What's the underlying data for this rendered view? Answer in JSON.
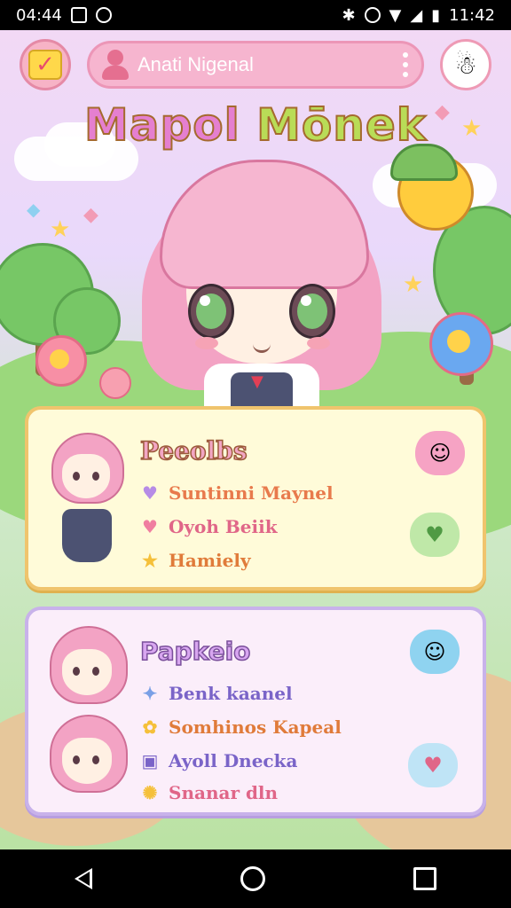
{
  "status_bar": {
    "time": "04:44",
    "clock_right": "11:42",
    "signal_label": "R"
  },
  "search": {
    "placeholder": "Anati Nigenal"
  },
  "app": {
    "title_part1": "Mapol",
    "title_part2": "Mōnek"
  },
  "card1": {
    "title": "Peeolbs",
    "items": [
      {
        "icon": "heart-icon",
        "text": "Suntinni Maynel",
        "color": "#e87a4c"
      },
      {
        "icon": "heart-icon",
        "text": "Oyoh Beiik",
        "color": "#e06688"
      },
      {
        "icon": "star-icon",
        "text": "Hamiely",
        "color": "#e07b3a"
      }
    ]
  },
  "card2": {
    "title": "Papkeio",
    "items": [
      {
        "icon": "sparkle-icon",
        "text": "Benk kaanel",
        "color": "#7a64c8"
      },
      {
        "icon": "flower-icon",
        "text": "Somhinos Kapeal",
        "color": "#e07b3a"
      },
      {
        "icon": "label-icon",
        "text": "Ayoll Dnecka",
        "color": "#7a64c8"
      },
      {
        "icon": "sparkle-icon",
        "text": "Snanar dln",
        "color": "#e06688"
      }
    ]
  },
  "colors": {
    "accent_pink": "#f6b5cf",
    "card_yellow": "#fffbd9",
    "card_purple": "#fbeefa"
  }
}
